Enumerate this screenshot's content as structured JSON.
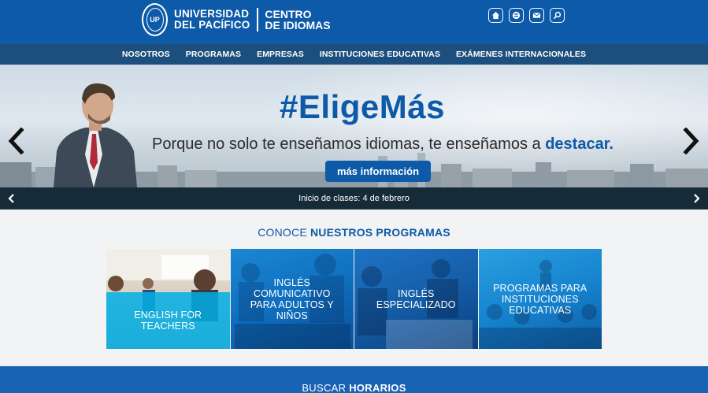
{
  "header": {
    "brand_line1": "UNIVERSIDAD",
    "brand_line2": "DEL PACÍFICO",
    "brand2_line1": "CENTRO",
    "brand2_line2": "DE IDIOMAS",
    "icons": [
      "home-icon",
      "blog-icon",
      "mail-icon",
      "search-icon"
    ]
  },
  "nav": {
    "items": [
      "NOSOTROS",
      "PROGRAMAS",
      "EMPRESAS",
      "INSTITUCIONES EDUCATIVAS",
      "EXÁMENES INTERNACIONALES"
    ]
  },
  "hero": {
    "title": "#EligeMás",
    "subtitle_start": "Porque no solo te enseñamos idiomas, te enseñamos a ",
    "subtitle_emphasis": "destacar.",
    "button": "más información"
  },
  "infobar": {
    "text": "Inicio de clases: 4 de febrero"
  },
  "programs": {
    "title_start": "CONOCE ",
    "title_bold": "NUESTROS PROGRAMAS",
    "cards": [
      {
        "line1": "ENGLISH FOR",
        "line2": "TEACHERS",
        "line3": "",
        "line4": ""
      },
      {
        "line1": "INGLÉS",
        "line2": "COMUNICATIVO",
        "line3": "PARA ADULTOS Y",
        "line4": "NIÑOS"
      },
      {
        "line1": "INGLÉS",
        "line2": "ESPECIALIZADO",
        "line3": "",
        "line4": ""
      },
      {
        "line1": "PROGRAMAS PARA",
        "line2": "INSTITUCIONES",
        "line3": "EDUCATIVAS",
        "line4": ""
      }
    ]
  },
  "schedule": {
    "title_start": "BUSCAR ",
    "title_bold": "HORARIOS"
  },
  "colors": {
    "primary": "#0d5aa8",
    "nav": "#1d4f7e",
    "infobar": "#152b38",
    "cyan": "#00afe6"
  }
}
